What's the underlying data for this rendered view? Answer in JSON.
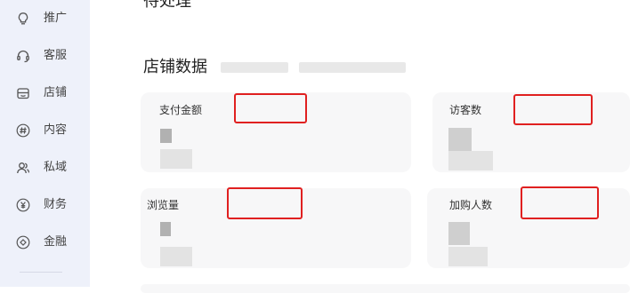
{
  "sidebar": {
    "items": [
      {
        "label": "推广",
        "icon": "lightbulb-icon"
      },
      {
        "label": "客服",
        "icon": "headset-icon"
      },
      {
        "label": "店铺",
        "icon": "store-icon"
      },
      {
        "label": "内容",
        "icon": "hashtag-icon"
      },
      {
        "label": "私域",
        "icon": "users-icon"
      },
      {
        "label": "财务",
        "icon": "yuan-icon"
      },
      {
        "label": "金融",
        "icon": "finance-icon"
      }
    ]
  },
  "main": {
    "top_section_title": "待处理",
    "section_title": "店铺数据",
    "metrics": [
      {
        "label": "支付金额"
      },
      {
        "label": "访客数"
      },
      {
        "label": "浏览量"
      },
      {
        "label": "加购人数"
      }
    ]
  },
  "colors": {
    "sidebar_bg": "#eef1fa",
    "highlight": "#e02020",
    "card_bg": "#f7f7f8"
  }
}
